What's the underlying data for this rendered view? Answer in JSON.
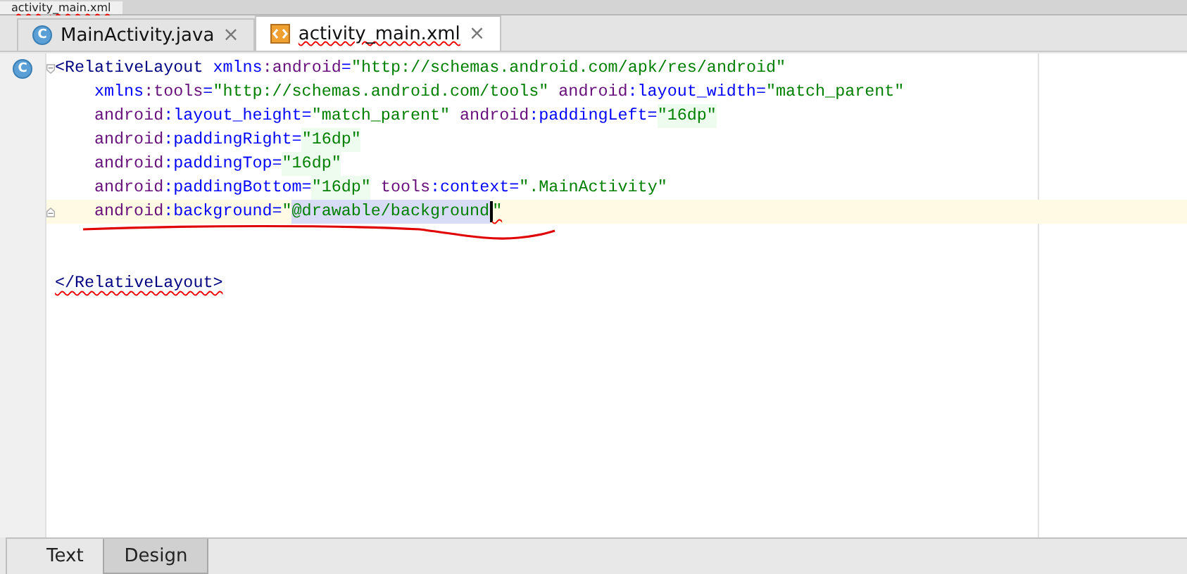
{
  "window_tab": {
    "label": "activity_main.xml"
  },
  "tabs": [
    {
      "label": "MainActivity.java",
      "icon_letter": "C",
      "kind": "java",
      "selected": false,
      "close": "×"
    },
    {
      "label": "activity_main.xml",
      "kind": "xml",
      "selected": true,
      "close": "×"
    }
  ],
  "editor": {
    "lines": [
      {
        "kind": "code",
        "gutter_mark": "C",
        "fold_start": true,
        "fold_end": false,
        "indent": false,
        "current": false,
        "tokens": [
          {
            "kind": "tag",
            "text": "<RelativeLayout"
          },
          {
            "kind": "attr",
            "text": " xmlns"
          },
          {
            "kind": "ns",
            "text": ":android"
          },
          {
            "kind": "attr",
            "text": "="
          },
          {
            "kind": "value",
            "text": "\"http://schemas.android.com/apk/res/android\""
          }
        ]
      },
      {
        "kind": "code",
        "indent": true,
        "current": false,
        "tokens": [
          {
            "kind": "attr",
            "text": "xmlns"
          },
          {
            "kind": "ns",
            "text": ":tools"
          },
          {
            "kind": "attr",
            "text": "="
          },
          {
            "kind": "value",
            "text": "\"http://schemas.android.com/tools\""
          },
          {
            "kind": "ns",
            "text": " android"
          },
          {
            "kind": "attr",
            "text": ":layout_width="
          },
          {
            "kind": "value",
            "text": "\"match_parent\""
          }
        ]
      },
      {
        "kind": "code",
        "indent": true,
        "current": false,
        "tokens": [
          {
            "kind": "ns",
            "text": "android"
          },
          {
            "kind": "attr",
            "text": ":layout_height="
          },
          {
            "kind": "value",
            "text": "\"match_parent\""
          },
          {
            "kind": "ns",
            "text": " android"
          },
          {
            "kind": "attr",
            "text": ":paddingLeft="
          },
          {
            "kind": "dimen",
            "text": "\"16dp\""
          }
        ]
      },
      {
        "kind": "code",
        "indent": true,
        "current": false,
        "tokens": [
          {
            "kind": "ns",
            "text": "android"
          },
          {
            "kind": "attr",
            "text": ":paddingRight="
          },
          {
            "kind": "dimen",
            "text": "\"16dp\""
          }
        ]
      },
      {
        "kind": "code",
        "indent": true,
        "current": false,
        "tokens": [
          {
            "kind": "ns",
            "text": "android"
          },
          {
            "kind": "attr",
            "text": ":paddingTop="
          },
          {
            "kind": "dimen",
            "text": "\"16dp\""
          }
        ]
      },
      {
        "kind": "code",
        "indent": true,
        "current": false,
        "tokens": [
          {
            "kind": "ns",
            "text": "android"
          },
          {
            "kind": "attr",
            "text": ":paddingBottom="
          },
          {
            "kind": "dimen",
            "text": "\"16dp\""
          },
          {
            "kind": "ns",
            "text": " tools"
          },
          {
            "kind": "attr",
            "text": ":context="
          },
          {
            "kind": "value",
            "text": "\".MainActivity\""
          }
        ]
      },
      {
        "kind": "code",
        "fold_start": false,
        "fold_end": true,
        "indent": true,
        "current": true,
        "tokens": [
          {
            "kind": "ns",
            "text": "android"
          },
          {
            "kind": "attr",
            "text": ":background="
          },
          {
            "kind": "value",
            "text": "\""
          },
          {
            "kind": "selection",
            "text": "@drawable/background"
          },
          {
            "kind": "caret"
          },
          {
            "kind": "value",
            "text": "\"",
            "error": true
          }
        ]
      },
      {
        "kind": "blank"
      },
      {
        "kind": "blank"
      },
      {
        "kind": "code",
        "indent": false,
        "current": false,
        "tokens": [
          {
            "kind": "tag",
            "text": "</RelativeLayout>",
            "error": true
          }
        ]
      }
    ]
  },
  "bottom_tabs": [
    {
      "label": "Text",
      "selected": true
    },
    {
      "label": "Design",
      "selected": false
    }
  ]
}
